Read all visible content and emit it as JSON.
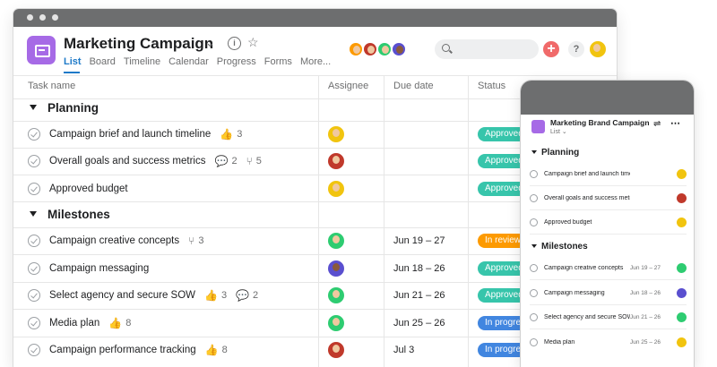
{
  "project": {
    "title": "Marketing Campaign",
    "tabs": [
      "List",
      "Board",
      "Timeline",
      "Calendar",
      "Progress",
      "Forms",
      "More..."
    ]
  },
  "header": {
    "plus": "+",
    "help": "?",
    "info": "i",
    "chevron": "⌄",
    "star": "☆"
  },
  "columns": {
    "task": "Task name",
    "assignee": "Assignee",
    "due": "Due date",
    "status": "Status"
  },
  "sections": [
    {
      "name": "Planning",
      "tasks": [
        {
          "name": "Campaign brief and launch timeline",
          "likes": "3",
          "status": "Approved",
          "status_color": "#37c5ab"
        },
        {
          "name": "Overall goals and success metrics",
          "comments": "2",
          "subtasks": "5",
          "status": "Approved",
          "status_color": "#37c5ab"
        },
        {
          "name": "Approved budget",
          "status": "Approved",
          "status_color": "#37c5ab"
        }
      ]
    },
    {
      "name": "Milestones",
      "tasks": [
        {
          "name": "Campaign creative concepts",
          "subtasks": "3",
          "due": "Jun 19 – 27",
          "status": "In review",
          "status_color": "#fd9a00"
        },
        {
          "name": "Campaign messaging",
          "due": "Jun 18 – 26",
          "status": "Approved",
          "status_color": "#37c5ab"
        },
        {
          "name": "Select agency and secure SOW",
          "likes": "3",
          "comments": "2",
          "due": "Jun 21 – 26",
          "status": "Approved",
          "status_color": "#37c5ab"
        },
        {
          "name": "Media plan",
          "likes": "8",
          "due": "Jun 25 – 26",
          "status": "In progress",
          "status_color": "#4186e0"
        },
        {
          "name": "Campaign performance tracking",
          "likes": "8",
          "due": "Jul 3",
          "status": "In progress",
          "status_color": "#4186e0"
        }
      ]
    }
  ],
  "mobile": {
    "title": "Marketing Brand Campaign",
    "view": "List",
    "sections": [
      {
        "name": "Planning",
        "tasks": [
          {
            "name": "Campaign brief and launch timeline",
            "due": ""
          },
          {
            "name": "Overall goals and success metrics",
            "due": ""
          },
          {
            "name": "Approved budget",
            "due": ""
          }
        ]
      },
      {
        "name": "Milestones",
        "tasks": [
          {
            "name": "Campaign creative concepts",
            "due": "Jun 19 – 27"
          },
          {
            "name": "Campaign messaging",
            "due": "Jun 18 – 26"
          },
          {
            "name": "Select agency and secure SOW",
            "due": "Jun 21 – 26"
          },
          {
            "name": "Media plan",
            "due": "Jun 25 – 26"
          }
        ]
      }
    ]
  },
  "colors": {
    "accent": "#1e7ac8",
    "approved": "#37c5ab",
    "in_review": "#fd9a00",
    "in_progress": "#4186e0",
    "project_icon": "#a66ae6"
  }
}
